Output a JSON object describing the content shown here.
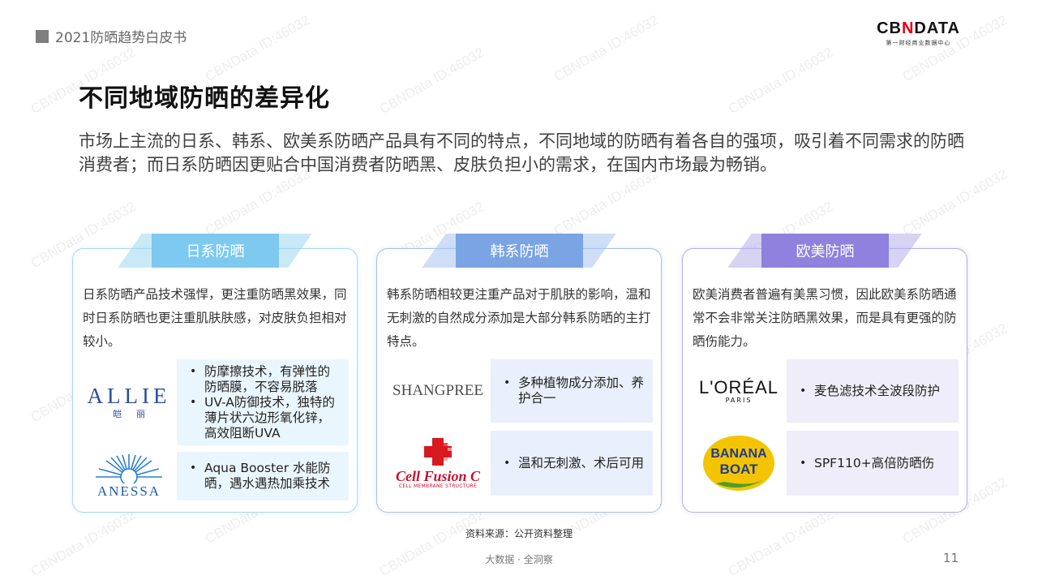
{
  "header": {
    "report_label": "2021防晒趋势白皮书"
  },
  "logo": {
    "part1": "CB",
    "part2": "N",
    "part3": "DATA",
    "subtitle": "第一财经商业数据中心"
  },
  "title": "不同地域防晒的差异化",
  "intro": "市场上主流的日系、韩系、欧美系防晒产品具有不同的特点，不同地域的防晒有着各自的强项，吸引着不同需求的防晒消费者；而日系防晒因更贴合中国消费者防晒黑、皮肤负担小的需求，在国内市场最为畅销。",
  "cards": {
    "jp": {
      "tab": "日系防晒",
      "desc": "日系防晒产品技术强悍，更注重防晒黑效果，同时日系防晒也更注重肌肤肤感，对皮肤负担相对较小。",
      "brands": [
        {
          "name_en": "ALLIE",
          "name_cn": "皑丽",
          "points": [
            "防摩擦技术，有弹性的防晒膜，不容易脱落",
            "UV-A防御技术，独特的薄片状六边形氧化锌，高效阻断UVA"
          ]
        },
        {
          "name_en": "ANESSA",
          "points": [
            "Aqua Booster 水能防晒，遇水遇热加乘技术"
          ]
        }
      ]
    },
    "kr": {
      "tab": "韩系防晒",
      "desc": "韩系防晒相较更注重产品对于肌肤的影响，温和无刺激的自然成分添加是大部分韩系防晒的主打特点。",
      "brands": [
        {
          "name_en": "SHANGPREE",
          "points": [
            "多种植物成分添加、养护合一"
          ]
        },
        {
          "name_en": "Cell Fusion C",
          "sub": "CELL MEMBRANE STRUCTURE",
          "points": [
            "温和无刺激、术后可用"
          ]
        }
      ]
    },
    "eu": {
      "tab": "欧美防晒",
      "desc": "欧美消费者普遍有美黑习惯，因此欧美系防晒通常不会非常关注防晒黑效果，而是具有更强的防晒伤能力。",
      "brands": [
        {
          "name_en": "L'ORÉAL",
          "sub": "PARIS",
          "points": [
            "麦色滤技术全波段防护"
          ]
        },
        {
          "name_en_1": "BANANA",
          "name_en_2": "BOAT",
          "points": [
            "SPF110+高倍防晒伤"
          ]
        }
      ]
    }
  },
  "source": "资料来源：公开资料整理",
  "footer_tag": "大数据 · 全洞察",
  "page_number": "11",
  "watermark": "CBNData ID:46032",
  "colors": {
    "jp_accent": "#7ec9ef",
    "kr_accent": "#7aa4e3",
    "eu_accent": "#8f81dd",
    "brand_red": "#e60012"
  }
}
